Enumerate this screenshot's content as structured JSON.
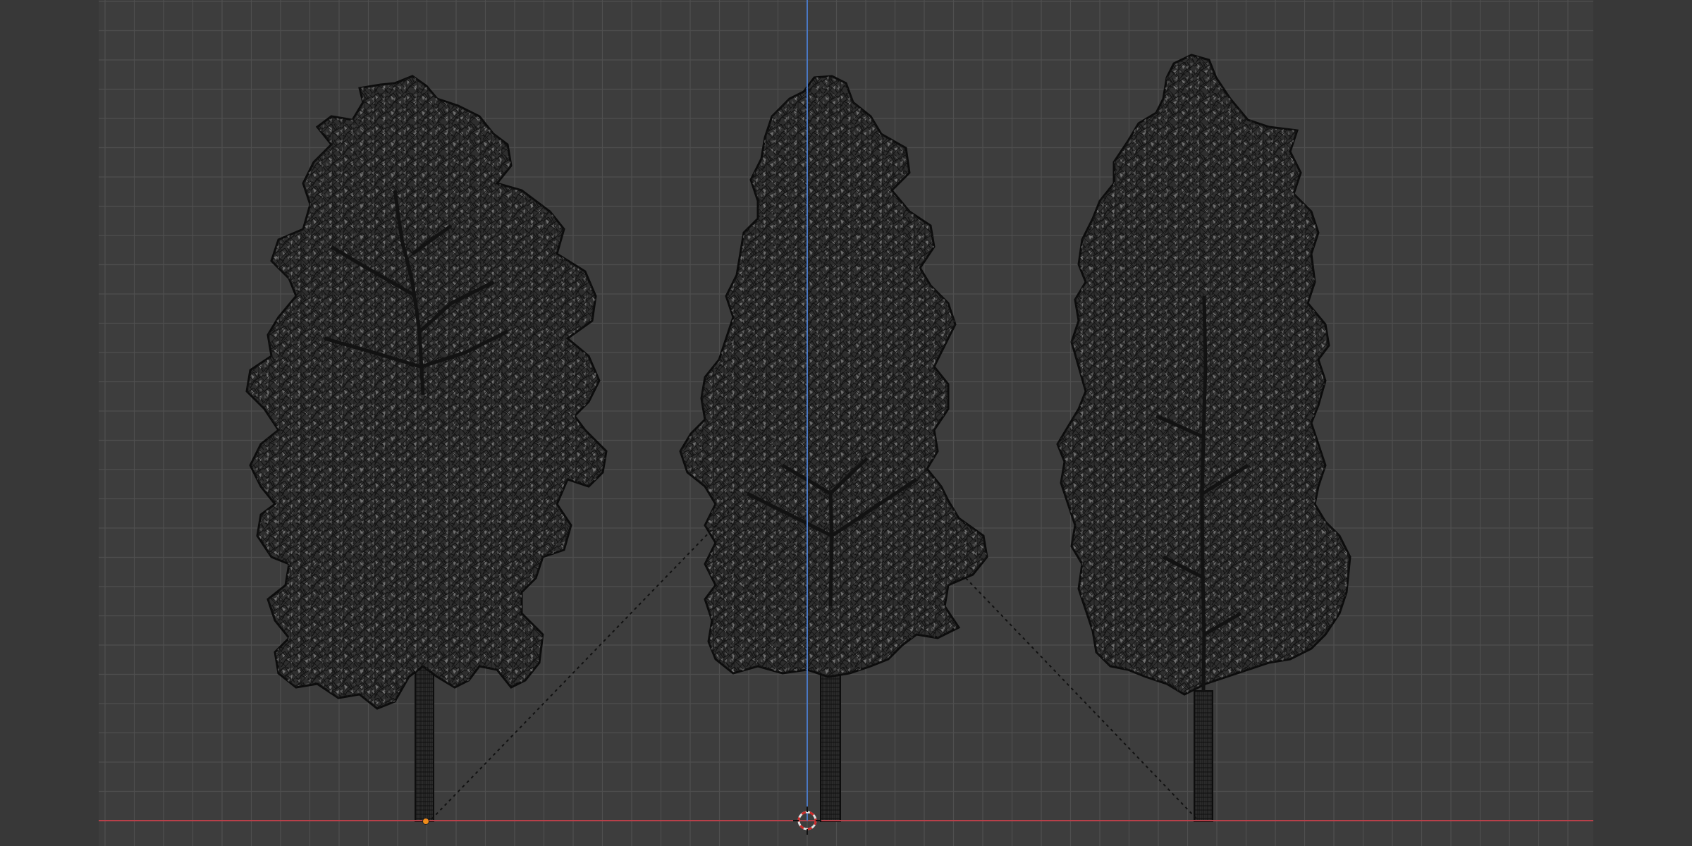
{
  "viewport": {
    "mode": "orthographic-front",
    "shading": "wireframe",
    "background_color": "#3d3d3d",
    "grid_color": "#4f4f4f",
    "x_axis_color": "#b8404a",
    "z_axis_color": "#4a78c4",
    "wire_color": "#0d0d0d",
    "origin_color": "#f08c1a"
  },
  "scene": {
    "objects": [
      {
        "name": "tree-left",
        "type": "mesh",
        "selected": false
      },
      {
        "name": "tree-center",
        "type": "mesh",
        "selected": false
      },
      {
        "name": "tree-right",
        "type": "mesh",
        "selected": false
      }
    ],
    "cursor_icon": "3d-cursor-icon",
    "origin_marker": "object-origin-icon"
  }
}
